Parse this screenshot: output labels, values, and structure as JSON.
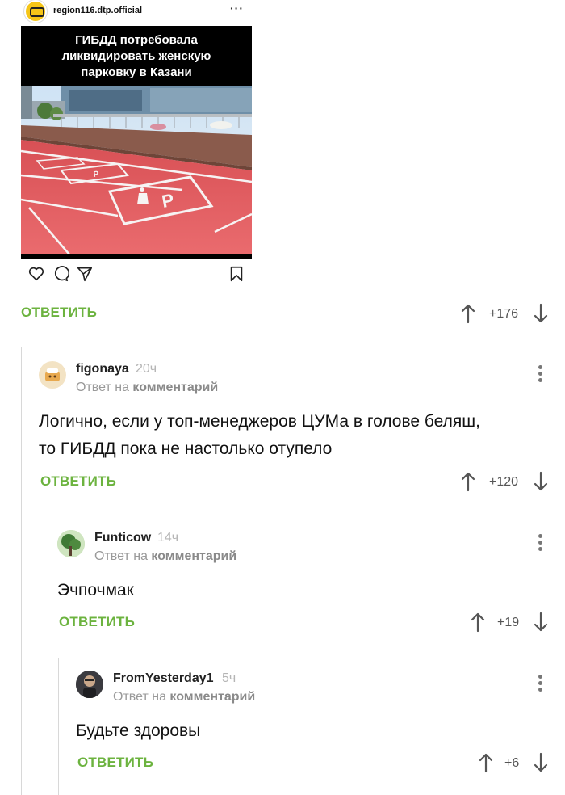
{
  "post": {
    "username": "region116.dtp.official",
    "more": "···",
    "headline": [
      "ГИБДД потребовала",
      "ликвидировать женскую",
      "парковку в Казани"
    ]
  },
  "colors": {
    "accent": "#6cb33f",
    "parking_red": "#e2585d",
    "muted": "#9a9a9a"
  },
  "icons": [
    "heart-icon",
    "comment-icon",
    "share-icon",
    "bookmark-icon",
    "arrow-up-icon",
    "arrow-down-icon",
    "kebab-icon"
  ],
  "top_actions": {
    "reply_label": "ОТВЕТИТЬ",
    "score": "+176"
  },
  "comments": [
    {
      "author": "figonaya",
      "time": "20ч",
      "meta_prefix": "Ответ на",
      "meta_link": "комментарий",
      "text_lines": [
        "Логично, если у топ-менеджеров ЦУМа в голове беляш,",
        "то ГИБДД пока не настолько отупело"
      ],
      "reply_label": "ОТВЕТИТЬ",
      "score": "+120"
    },
    {
      "author": "Funticow",
      "time": "14ч",
      "meta_prefix": "Ответ на",
      "meta_link": "комментарий",
      "text_lines": [
        "Эчпочмак"
      ],
      "reply_label": "ОТВЕТИТЬ",
      "score": "+19"
    },
    {
      "author": "FromYesterday1",
      "time": "5ч",
      "meta_prefix": "Ответ на",
      "meta_link": "комментарий",
      "text_lines": [
        "Будьте здоровы"
      ],
      "reply_label": "ОТВЕТИТЬ",
      "score": "+6"
    }
  ]
}
